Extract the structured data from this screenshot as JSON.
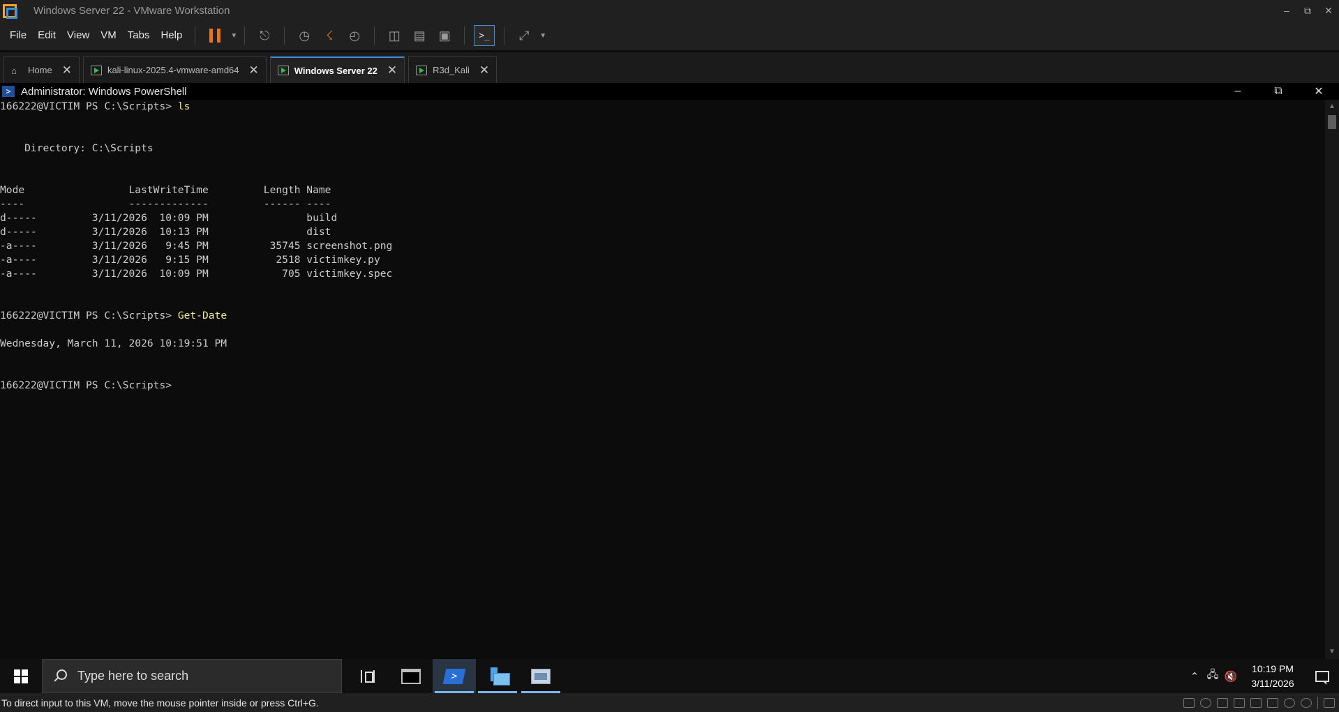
{
  "vmware": {
    "window_title": "Windows Server 22 - VMware Workstation",
    "menu": [
      "File",
      "Edit",
      "View",
      "VM",
      "Tabs",
      "Help"
    ],
    "tabs": [
      {
        "label": "Home",
        "selected": false
      },
      {
        "label": "kali-linux-2025.4-vmware-amd64",
        "selected": false
      },
      {
        "label": "Windows Server 22",
        "selected": true
      },
      {
        "label": "R3d_Kali",
        "selected": false
      }
    ],
    "status_message": "To direct input to this VM, move the mouse pointer inside or press Ctrl+G."
  },
  "powershell": {
    "title": "Administrator: Windows PowerShell",
    "lines": [
      {
        "text": "166222@VICTIM PS C:\\Scripts> ",
        "cmd": "ls"
      },
      {
        "text": ""
      },
      {
        "text": ""
      },
      {
        "text": "    Directory: C:\\Scripts"
      },
      {
        "text": ""
      },
      {
        "text": ""
      },
      {
        "text": "Mode                 LastWriteTime         Length Name"
      },
      {
        "text": "----                 -------------         ------ ----"
      },
      {
        "text": "d-----         3/11/2026  10:09 PM                build"
      },
      {
        "text": "d-----         3/11/2026  10:13 PM                dist"
      },
      {
        "text": "-a----         3/11/2026   9:45 PM          35745 screenshot.png"
      },
      {
        "text": "-a----         3/11/2026   9:15 PM           2518 victimkey.py"
      },
      {
        "text": "-a----         3/11/2026  10:09 PM            705 victimkey.spec"
      },
      {
        "text": ""
      },
      {
        "text": ""
      },
      {
        "text": "166222@VICTIM PS C:\\Scripts> ",
        "cmd": "Get-Date"
      },
      {
        "text": ""
      },
      {
        "text": "Wednesday, March 11, 2026 10:19:51 PM"
      },
      {
        "text": ""
      },
      {
        "text": ""
      },
      {
        "text": "166222@VICTIM PS C:\\Scripts>"
      }
    ]
  },
  "taskbar": {
    "search_placeholder": "Type here to search",
    "apps": [
      {
        "name": "task-view-icon"
      },
      {
        "name": "cmd-icon"
      },
      {
        "name": "powershell-icon"
      },
      {
        "name": "file-explorer-icon"
      },
      {
        "name": "server-manager-icon"
      }
    ],
    "clock_time": "10:19 PM",
    "clock_date": "3/11/2026"
  }
}
